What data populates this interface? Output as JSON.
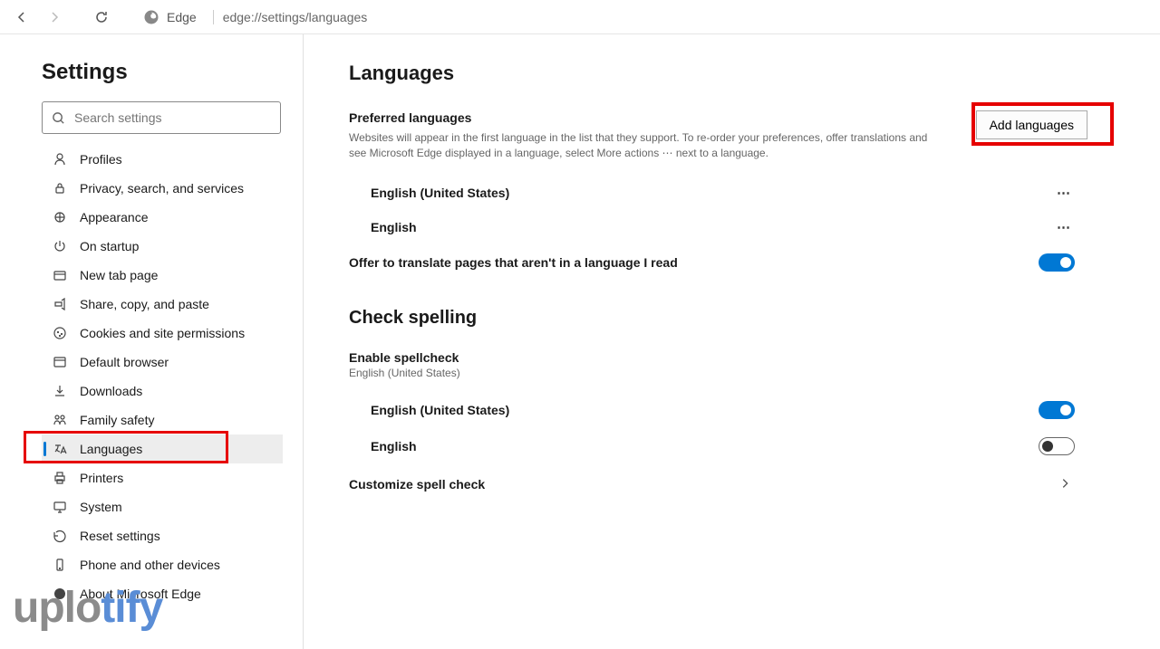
{
  "browser": {
    "product": "Edge",
    "url": "edge://settings/languages"
  },
  "sidebar": {
    "title": "Settings",
    "search_placeholder": "Search settings",
    "items": [
      {
        "label": "Profiles",
        "icon": "profile"
      },
      {
        "label": "Privacy, search, and services",
        "icon": "lock"
      },
      {
        "label": "Appearance",
        "icon": "palette"
      },
      {
        "label": "On startup",
        "icon": "power"
      },
      {
        "label": "New tab page",
        "icon": "tab"
      },
      {
        "label": "Share, copy, and paste",
        "icon": "share"
      },
      {
        "label": "Cookies and site permissions",
        "icon": "cookie"
      },
      {
        "label": "Default browser",
        "icon": "browser"
      },
      {
        "label": "Downloads",
        "icon": "download"
      },
      {
        "label": "Family safety",
        "icon": "family"
      },
      {
        "label": "Languages",
        "icon": "languages",
        "active": true
      },
      {
        "label": "Printers",
        "icon": "printer"
      },
      {
        "label": "System",
        "icon": "system"
      },
      {
        "label": "Reset settings",
        "icon": "reset"
      },
      {
        "label": "Phone and other devices",
        "icon": "phone"
      },
      {
        "label": "About Microsoft Edge",
        "icon": "about"
      }
    ]
  },
  "content": {
    "title": "Languages",
    "preferred": {
      "heading": "Preferred languages",
      "description": "Websites will appear in the first language in the list that they support. To re-order your preferences, offer translations and see Microsoft Edge displayed in a language, select More actions ⋯ next to a language.",
      "add_button": "Add languages",
      "languages": [
        {
          "name": "English (United States)"
        },
        {
          "name": "English"
        }
      ],
      "translate_label": "Offer to translate pages that aren't in a language I read",
      "translate_on": true
    },
    "spelling": {
      "heading": "Check spelling",
      "enable_label": "Enable spellcheck",
      "enable_desc": "English (United States)",
      "languages": [
        {
          "name": "English (United States)",
          "on": true
        },
        {
          "name": "English",
          "on": false
        }
      ],
      "customize_label": "Customize spell check"
    }
  },
  "watermark": {
    "p1": "uplo",
    "p2": "tify"
  }
}
